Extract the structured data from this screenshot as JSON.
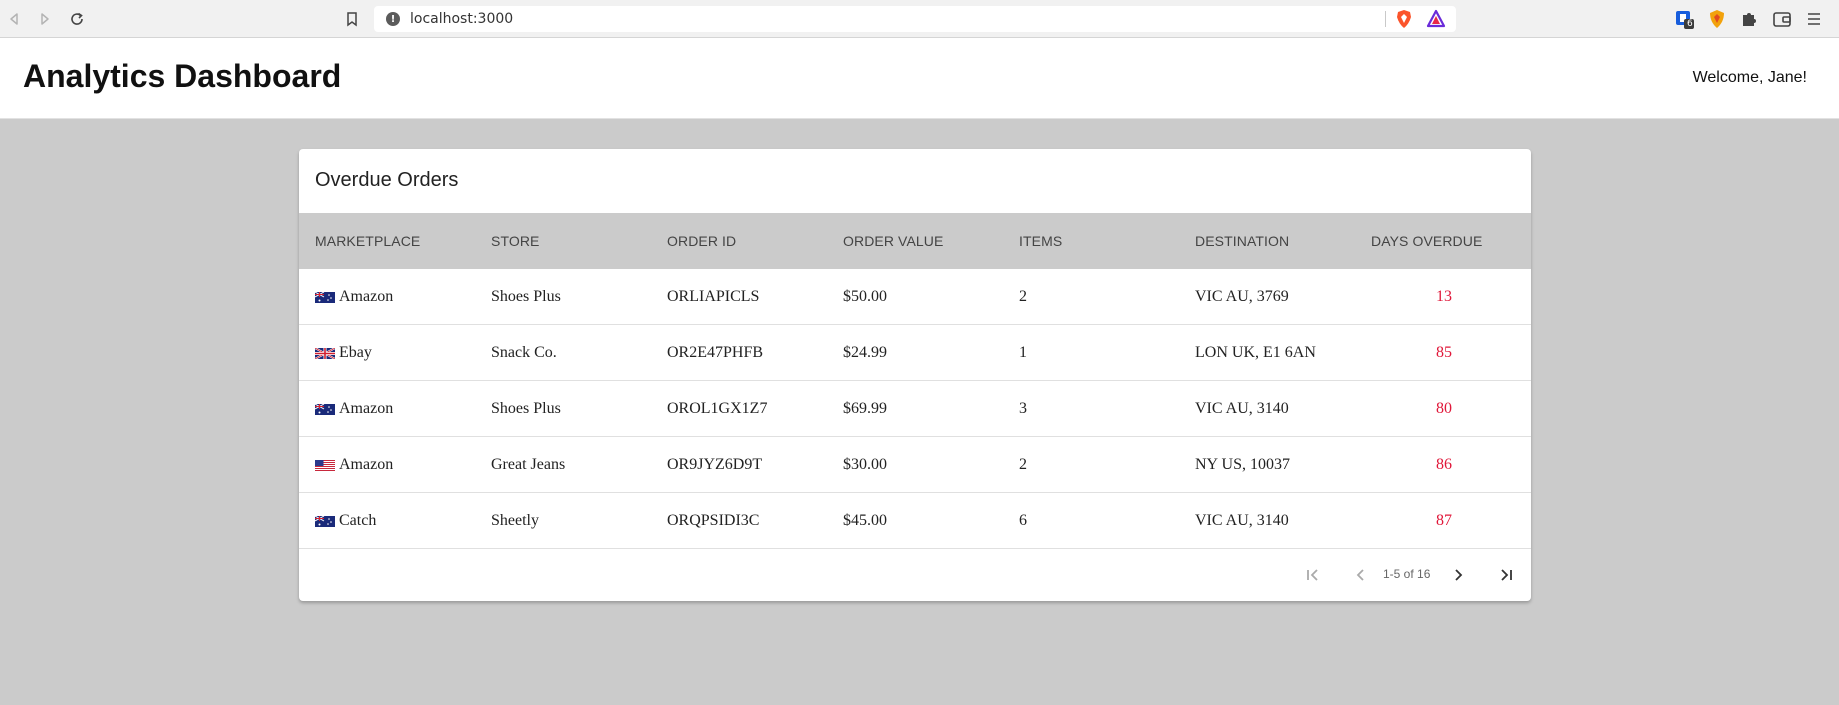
{
  "browser": {
    "url": "localhost:3000",
    "url_info_glyph": "!",
    "extension_badge": "6"
  },
  "header": {
    "title": "Analytics Dashboard",
    "welcome": "Welcome, Jane!"
  },
  "card": {
    "title": "Overdue Orders",
    "columns": [
      "MARKETPLACE",
      "STORE",
      "ORDER ID",
      "ORDER VALUE",
      "ITEMS",
      "DESTINATION",
      "DAYS OVERDUE"
    ],
    "rows": [
      {
        "flag": "au-flag-icon",
        "marketplace": "Amazon",
        "store": "Shoes Plus",
        "order_id": "ORLIAPICLS",
        "order_value": "$50.00",
        "items": "2",
        "destination": "VIC AU, 3769",
        "days_overdue": "13"
      },
      {
        "flag": "uk-flag-icon",
        "marketplace": "Ebay",
        "store": "Snack Co.",
        "order_id": "OR2E47PHFB",
        "order_value": "$24.99",
        "items": "1",
        "destination": "LON UK, E1 6AN",
        "days_overdue": "85"
      },
      {
        "flag": "au-flag-icon",
        "marketplace": "Amazon",
        "store": "Shoes Plus",
        "order_id": "OROL1GX1Z7",
        "order_value": "$69.99",
        "items": "3",
        "destination": "VIC AU, 3140",
        "days_overdue": "80"
      },
      {
        "flag": "us-flag-icon",
        "marketplace": "Amazon",
        "store": "Great Jeans",
        "order_id": "OR9JYZ6D9T",
        "order_value": "$30.00",
        "items": "2",
        "destination": "NY US, 10037",
        "days_overdue": "86"
      },
      {
        "flag": "au-flag-icon",
        "marketplace": "Catch",
        "store": "Sheetly",
        "order_id": "ORQPSIDI3C",
        "order_value": "$45.00",
        "items": "6",
        "destination": "VIC AU, 3140",
        "days_overdue": "87"
      }
    ],
    "pagination": {
      "range_text": "1-5 of 16"
    }
  },
  "colors": {
    "overdue": "#e0183a",
    "page_bg": "#cbcbcb",
    "table_header_bg": "#cbcbcb"
  }
}
